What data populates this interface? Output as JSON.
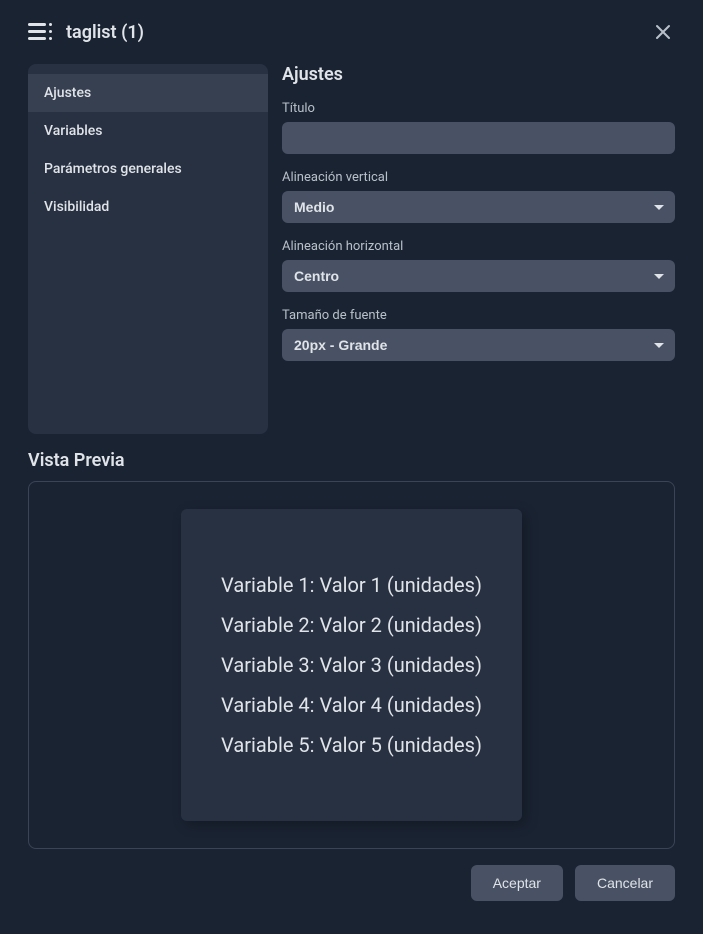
{
  "header": {
    "title": "taglist (1)"
  },
  "sidebar": {
    "items": [
      {
        "label": "Ajustes",
        "active": true
      },
      {
        "label": "Variables",
        "active": false
      },
      {
        "label": "Parámetros generales",
        "active": false
      },
      {
        "label": "Visibilidad",
        "active": false
      }
    ]
  },
  "panel": {
    "title": "Ajustes",
    "fields": {
      "titulo_label": "Título",
      "titulo_value": "",
      "valign_label": "Alineación vertical",
      "valign_value": "Medio",
      "halign_label": "Alineación horizontal",
      "halign_value": "Centro",
      "fontsize_label": "Tamaño de fuente",
      "fontsize_value": "20px - Grande"
    }
  },
  "preview": {
    "title": "Vista Previa",
    "rows": [
      {
        "name": "Variable 1:",
        "value": "Valor 1",
        "units": "(unidades)"
      },
      {
        "name": "Variable 2:",
        "value": "Valor 2",
        "units": "(unidades)"
      },
      {
        "name": "Variable 3:",
        "value": "Valor 3",
        "units": "(unidades)"
      },
      {
        "name": "Variable 4:",
        "value": "Valor 4",
        "units": "(unidades)"
      },
      {
        "name": "Variable 5:",
        "value": "Valor 5",
        "units": "(unidades)"
      }
    ]
  },
  "footer": {
    "accept": "Aceptar",
    "cancel": "Cancelar"
  }
}
